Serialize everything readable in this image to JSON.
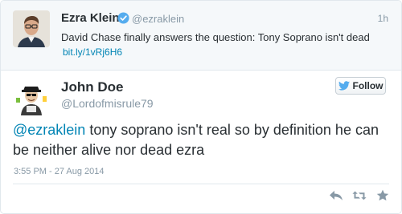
{
  "parent_tweet": {
    "name": "Ezra Klein",
    "handle": "@ezraklein",
    "time": "1h",
    "text": "David Chase finally answers the question: Tony Soprano isn't dead",
    "link": "bit.ly/1vRj6H6",
    "verified": true
  },
  "tweet": {
    "name": "John Doe",
    "handle": "@Lordofmisrule79",
    "follow_label": "Follow",
    "mention": "@ezraklein",
    "text": " tony soprano isn't real so by definition he can be neither alive nor dead ezra",
    "timestamp": "3:55 PM - 27 Aug 2014"
  },
  "actions": [
    "reply-icon",
    "retweet-icon",
    "favorite-icon"
  ],
  "colors": {
    "link": "#0084b4",
    "twitter_blue": "#55acee",
    "muted": "#8899a6",
    "text": "#292f33",
    "parent_bg": "#f5f8fa"
  }
}
